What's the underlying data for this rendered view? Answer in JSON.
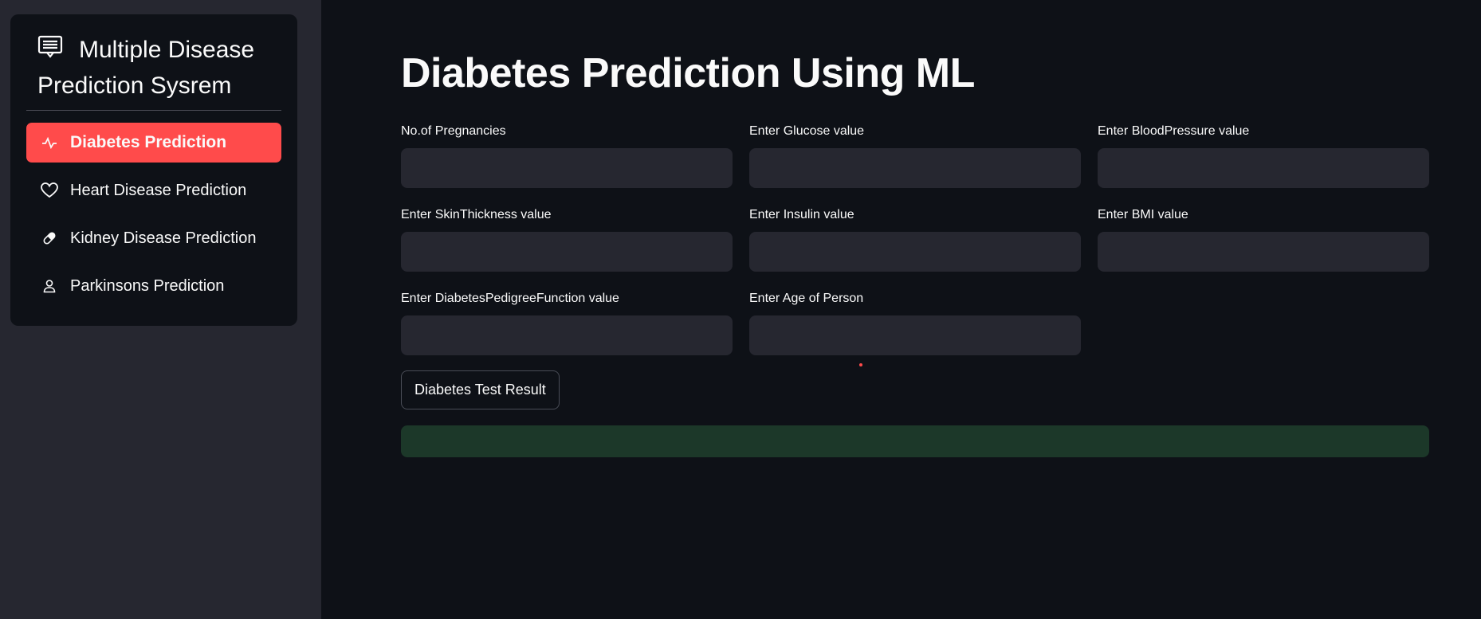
{
  "sidebar": {
    "title": "Multiple Disease Prediction Sysrem",
    "title_icon": "menu-list-icon",
    "items": [
      {
        "label": "Diabetes Prediction",
        "icon": "activity-icon",
        "active": true
      },
      {
        "label": "Heart Disease Prediction",
        "icon": "heart-icon",
        "active": false
      },
      {
        "label": "Kidney Disease Prediction",
        "icon": "capsule-icon",
        "active": false
      },
      {
        "label": "Parkinsons Prediction",
        "icon": "person-icon",
        "active": false
      }
    ],
    "accent_color": "#ff4b4b"
  },
  "main": {
    "title": "Diabetes Prediction Using ML",
    "fields": [
      {
        "label": "No.of Pregnancies",
        "value": ""
      },
      {
        "label": "Enter Glucose value",
        "value": ""
      },
      {
        "label": "Enter BloodPressure value",
        "value": ""
      },
      {
        "label": "Enter SkinThickness value",
        "value": ""
      },
      {
        "label": "Enter Insulin value",
        "value": ""
      },
      {
        "label": "Enter BMI value",
        "value": ""
      },
      {
        "label": "Enter DiabetesPedigreeFunction value",
        "value": ""
      },
      {
        "label": "Enter Age of Person",
        "value": ""
      }
    ],
    "button_label": "Diabetes Test Result",
    "result_text": "",
    "result_color": "#1c3829"
  }
}
